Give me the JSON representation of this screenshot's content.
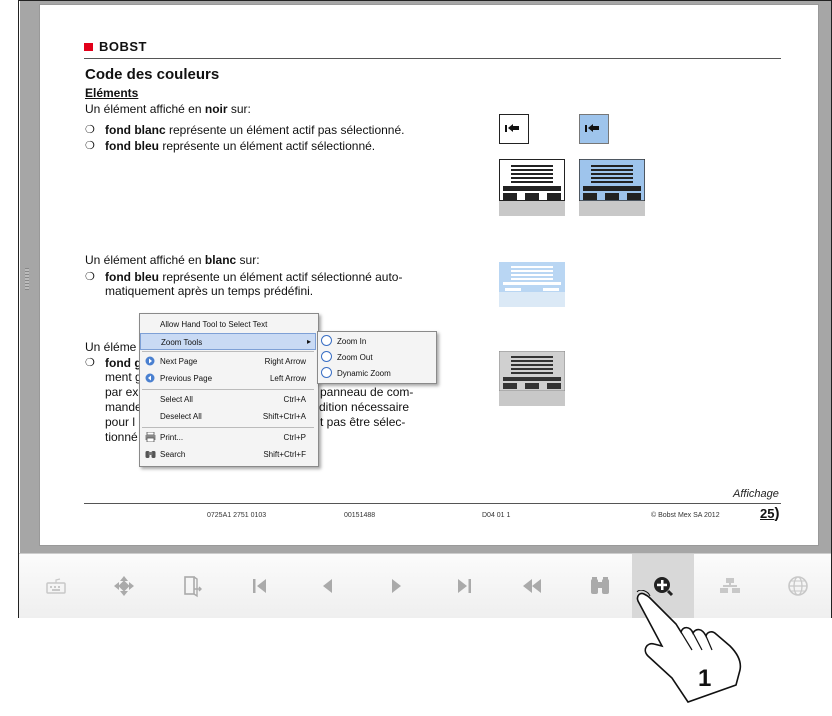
{
  "document": {
    "logo_text": "BOBST",
    "title": "Code des couleurs",
    "subtitle": "Eléments",
    "section1": {
      "intro_pre": "Un élément affiché en ",
      "intro_bold": "noir",
      "intro_post": " sur:",
      "bullet1_bold": "fond blanc",
      "bullet1_text": " représente un élément actif pas sélectionné.",
      "bullet2_bold": "fond bleu",
      "bullet2_text": " représente un élément actif sélectionné."
    },
    "section2": {
      "intro_pre": "Un élément affiché en ",
      "intro_bold": "blanc",
      "intro_post": " sur:",
      "bullet1_bold": "fond bleu",
      "bullet1_text_line1": " représente un élément actif sélectionné auto-",
      "bullet1_text_line2": "matiquement après un temps prédéfini."
    },
    "section3": {
      "intro_visible": "Un éléme",
      "bullet_bold_visible": "fond g",
      "line2": "ment g",
      "line3_left": "par ex",
      "line3_right": "panneau de com-",
      "line4_left": "mande",
      "line4_right": "dition nécessaire",
      "line5_left": "pour l",
      "line5_right": "t pas être sélec-",
      "line6_left": "tionné"
    },
    "footer": {
      "code1": "0725A1 2751 0103",
      "code2": "00151488",
      "code3": "D04 01 1",
      "copyright": "© Bobst Mex SA 2012",
      "section": "Affichage",
      "page": "25"
    }
  },
  "context_menu": {
    "items": [
      {
        "label": "Allow Hand Tool to Select Text",
        "shortcut": ""
      },
      {
        "label": "Zoom Tools",
        "shortcut": ""
      },
      {
        "label": "Next Page",
        "shortcut": "Right Arrow"
      },
      {
        "label": "Previous Page",
        "shortcut": "Left Arrow"
      },
      {
        "label": "Select All",
        "shortcut": "Ctrl+A"
      },
      {
        "label": "Deselect All",
        "shortcut": "Shift+Ctrl+A"
      },
      {
        "label": "Print...",
        "shortcut": "Ctrl+P"
      },
      {
        "label": "Search",
        "shortcut": "Shift+Ctrl+F"
      }
    ],
    "submenu": [
      {
        "label": "Zoom In"
      },
      {
        "label": "Zoom Out"
      },
      {
        "label": "Dynamic Zoom"
      }
    ]
  },
  "toolbar": {
    "buttons": [
      "keyboard-icon",
      "navigation-pad-icon",
      "exit-document-icon",
      "first-page-icon",
      "previous-page-icon",
      "next-page-icon",
      "last-page-icon",
      "rewind-icon",
      "binoculars-icon",
      "zoom-icon",
      "hierarchy-icon",
      "globe-icon"
    ],
    "active": "zoom-icon"
  },
  "callout": {
    "number": "1"
  },
  "colors": {
    "brand_red": "#e2001a",
    "selected_blue": "#9ec4ec",
    "menu_highlight": "#c9daf4"
  }
}
